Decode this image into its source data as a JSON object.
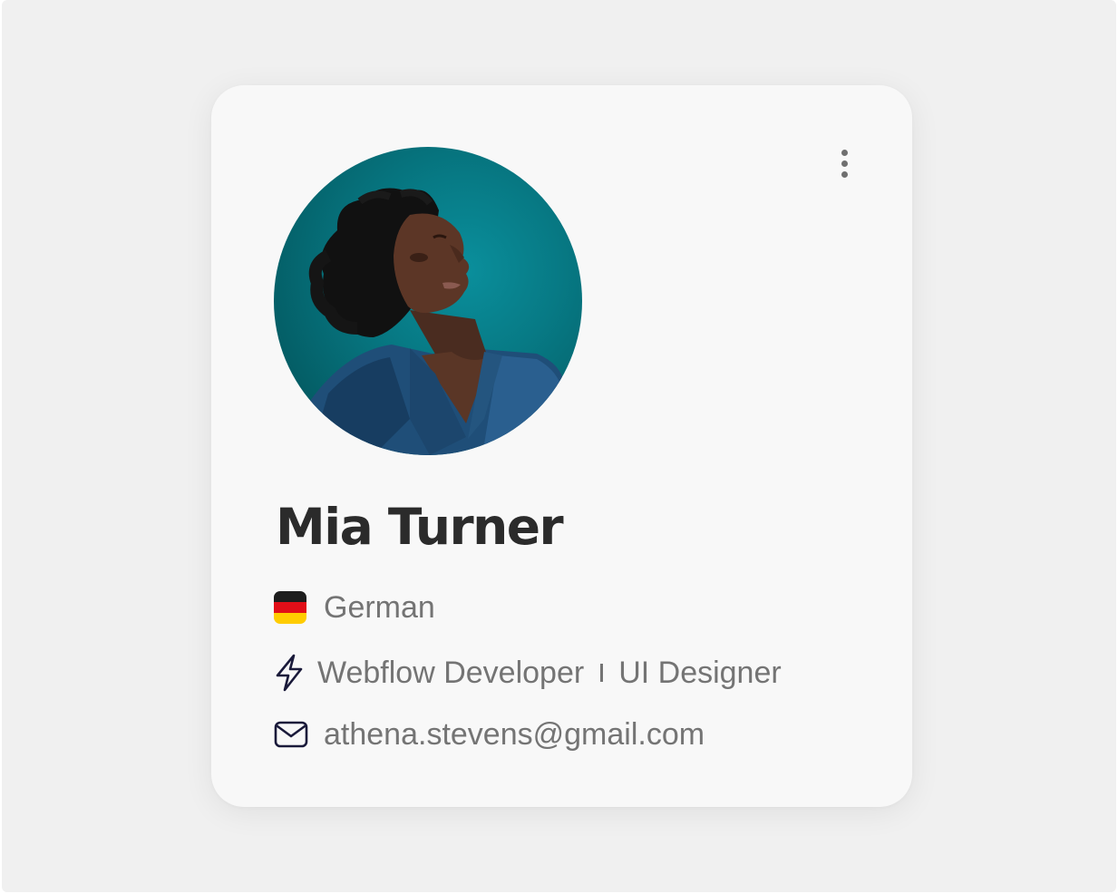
{
  "profile": {
    "name": "Mia Turner",
    "language": "German",
    "roles": [
      "Webflow Developer",
      "UI Designer"
    ],
    "email": "athena.stevens@gmail.com"
  },
  "icons": {
    "menu": "more-vertical-icon",
    "flag": "flag-germany-icon",
    "role": "lightning-bolt-icon",
    "email": "mail-envelope-icon"
  },
  "colors": {
    "background": "#f0f0f0",
    "card": "#f8f8f8",
    "name_text": "#2b2b2b",
    "detail_text": "#747474",
    "icon_stroke": "#1a1a3a",
    "avatar_background": "#077a85"
  }
}
